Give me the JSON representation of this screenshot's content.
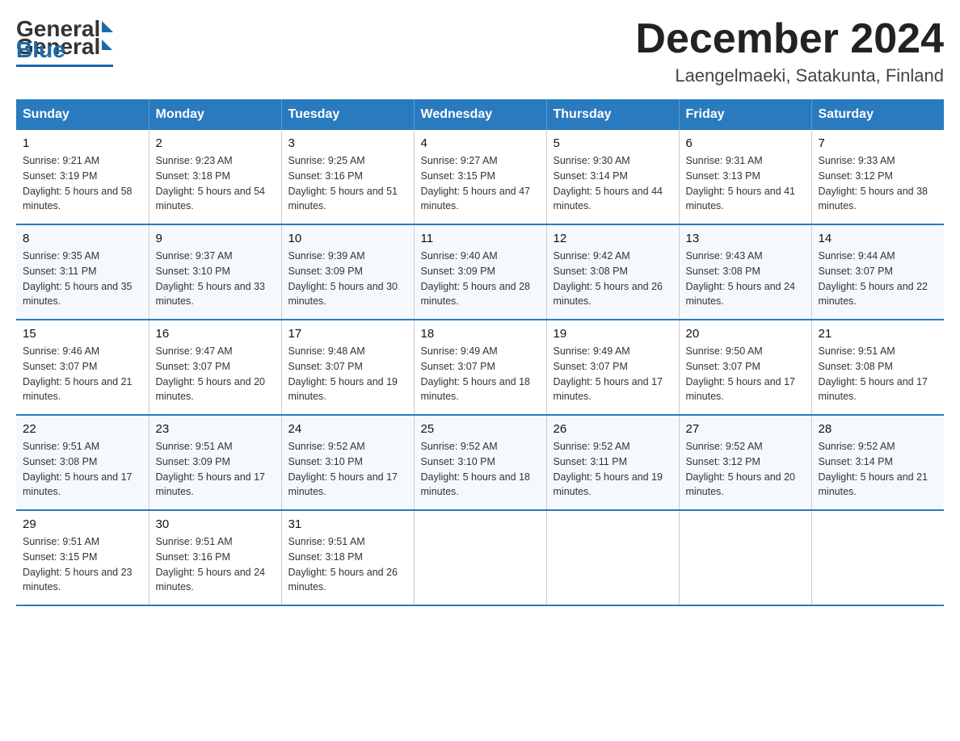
{
  "logo": {
    "general": "General",
    "blue": "Blue"
  },
  "title": "December 2024",
  "subtitle": "Laengelmaeki, Satakunta, Finland",
  "days_of_week": [
    "Sunday",
    "Monday",
    "Tuesday",
    "Wednesday",
    "Thursday",
    "Friday",
    "Saturday"
  ],
  "weeks": [
    [
      {
        "day": 1,
        "sunrise": "9:21 AM",
        "sunset": "3:19 PM",
        "daylight": "5 hours and 58 minutes."
      },
      {
        "day": 2,
        "sunrise": "9:23 AM",
        "sunset": "3:18 PM",
        "daylight": "5 hours and 54 minutes."
      },
      {
        "day": 3,
        "sunrise": "9:25 AM",
        "sunset": "3:16 PM",
        "daylight": "5 hours and 51 minutes."
      },
      {
        "day": 4,
        "sunrise": "9:27 AM",
        "sunset": "3:15 PM",
        "daylight": "5 hours and 47 minutes."
      },
      {
        "day": 5,
        "sunrise": "9:30 AM",
        "sunset": "3:14 PM",
        "daylight": "5 hours and 44 minutes."
      },
      {
        "day": 6,
        "sunrise": "9:31 AM",
        "sunset": "3:13 PM",
        "daylight": "5 hours and 41 minutes."
      },
      {
        "day": 7,
        "sunrise": "9:33 AM",
        "sunset": "3:12 PM",
        "daylight": "5 hours and 38 minutes."
      }
    ],
    [
      {
        "day": 8,
        "sunrise": "9:35 AM",
        "sunset": "3:11 PM",
        "daylight": "5 hours and 35 minutes."
      },
      {
        "day": 9,
        "sunrise": "9:37 AM",
        "sunset": "3:10 PM",
        "daylight": "5 hours and 33 minutes."
      },
      {
        "day": 10,
        "sunrise": "9:39 AM",
        "sunset": "3:09 PM",
        "daylight": "5 hours and 30 minutes."
      },
      {
        "day": 11,
        "sunrise": "9:40 AM",
        "sunset": "3:09 PM",
        "daylight": "5 hours and 28 minutes."
      },
      {
        "day": 12,
        "sunrise": "9:42 AM",
        "sunset": "3:08 PM",
        "daylight": "5 hours and 26 minutes."
      },
      {
        "day": 13,
        "sunrise": "9:43 AM",
        "sunset": "3:08 PM",
        "daylight": "5 hours and 24 minutes."
      },
      {
        "day": 14,
        "sunrise": "9:44 AM",
        "sunset": "3:07 PM",
        "daylight": "5 hours and 22 minutes."
      }
    ],
    [
      {
        "day": 15,
        "sunrise": "9:46 AM",
        "sunset": "3:07 PM",
        "daylight": "5 hours and 21 minutes."
      },
      {
        "day": 16,
        "sunrise": "9:47 AM",
        "sunset": "3:07 PM",
        "daylight": "5 hours and 20 minutes."
      },
      {
        "day": 17,
        "sunrise": "9:48 AM",
        "sunset": "3:07 PM",
        "daylight": "5 hours and 19 minutes."
      },
      {
        "day": 18,
        "sunrise": "9:49 AM",
        "sunset": "3:07 PM",
        "daylight": "5 hours and 18 minutes."
      },
      {
        "day": 19,
        "sunrise": "9:49 AM",
        "sunset": "3:07 PM",
        "daylight": "5 hours and 17 minutes."
      },
      {
        "day": 20,
        "sunrise": "9:50 AM",
        "sunset": "3:07 PM",
        "daylight": "5 hours and 17 minutes."
      },
      {
        "day": 21,
        "sunrise": "9:51 AM",
        "sunset": "3:08 PM",
        "daylight": "5 hours and 17 minutes."
      }
    ],
    [
      {
        "day": 22,
        "sunrise": "9:51 AM",
        "sunset": "3:08 PM",
        "daylight": "5 hours and 17 minutes."
      },
      {
        "day": 23,
        "sunrise": "9:51 AM",
        "sunset": "3:09 PM",
        "daylight": "5 hours and 17 minutes."
      },
      {
        "day": 24,
        "sunrise": "9:52 AM",
        "sunset": "3:10 PM",
        "daylight": "5 hours and 17 minutes."
      },
      {
        "day": 25,
        "sunrise": "9:52 AM",
        "sunset": "3:10 PM",
        "daylight": "5 hours and 18 minutes."
      },
      {
        "day": 26,
        "sunrise": "9:52 AM",
        "sunset": "3:11 PM",
        "daylight": "5 hours and 19 minutes."
      },
      {
        "day": 27,
        "sunrise": "9:52 AM",
        "sunset": "3:12 PM",
        "daylight": "5 hours and 20 minutes."
      },
      {
        "day": 28,
        "sunrise": "9:52 AM",
        "sunset": "3:14 PM",
        "daylight": "5 hours and 21 minutes."
      }
    ],
    [
      {
        "day": 29,
        "sunrise": "9:51 AM",
        "sunset": "3:15 PM",
        "daylight": "5 hours and 23 minutes."
      },
      {
        "day": 30,
        "sunrise": "9:51 AM",
        "sunset": "3:16 PM",
        "daylight": "5 hours and 24 minutes."
      },
      {
        "day": 31,
        "sunrise": "9:51 AM",
        "sunset": "3:18 PM",
        "daylight": "5 hours and 26 minutes."
      },
      null,
      null,
      null,
      null
    ]
  ]
}
